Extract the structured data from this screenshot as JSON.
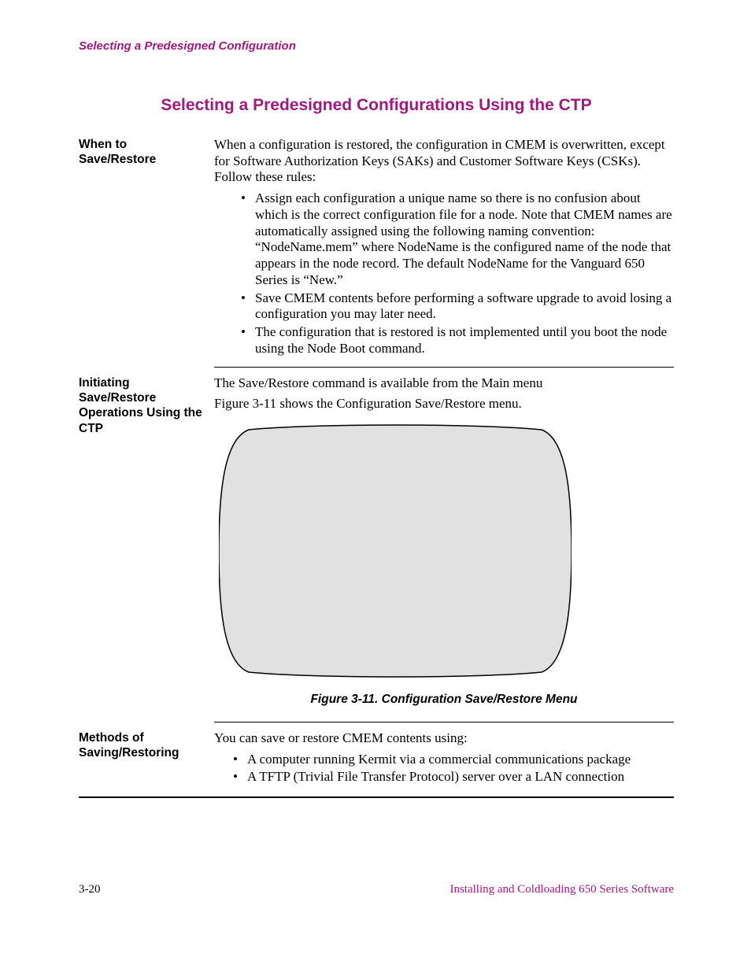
{
  "header": {
    "running": "Selecting a Predesigned Configuration",
    "title": "Selecting a Predesigned Configurations Using the CTP"
  },
  "sections": {
    "when": {
      "label": "When to Save/Restore",
      "intro": "When a configuration is restored, the configuration in CMEM is overwritten, except for Software Authorization Keys (SAKs) and Customer Software Keys (CSKs). Follow these rules:",
      "bullets": [
        "Assign each configuration a unique name so there is no confusion about which is the correct configuration file for a node. Note that CMEM names are automatically assigned using the following naming convention: “NodeName.mem” where NodeName is the configured name of the node that appears in the node record. The default NodeName for the Vanguard 650 Series is “New.”",
        "Save CMEM contents before performing a software upgrade to avoid losing a configuration you may later need.",
        "The configuration that is restored is not implemented until you boot the node using the Node Boot command."
      ]
    },
    "initiating": {
      "label": "Initiating Save/Restore Operations Using the CTP",
      "p1": "The Save/Restore command is available from the Main menu",
      "p2": "Figure 3-11 shows the Configuration Save/Restore menu.",
      "figure_caption": "Figure 3-11. Configuration Save/Restore Menu"
    },
    "methods": {
      "label": "Methods of Saving/Restoring",
      "intro": "You can save or restore CMEM contents using:",
      "bullets": [
        "A computer running Kermit via a commercial communications package",
        "A TFTP (Trivial File Transfer Protocol) server over a LAN connection"
      ]
    }
  },
  "footer": {
    "pageno": "3-20",
    "docname": "Installing and Coldloading 650 Series Software"
  }
}
